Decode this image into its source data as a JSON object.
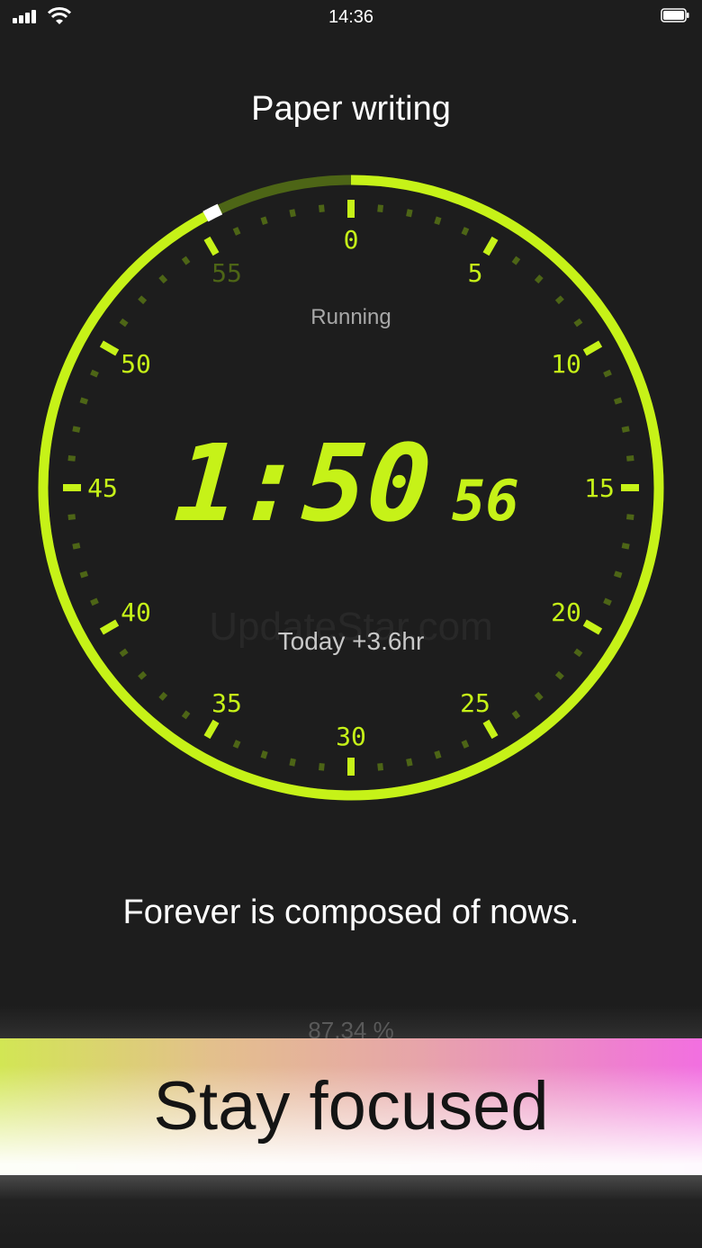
{
  "status_bar": {
    "time": "14:36",
    "icons": [
      "cellular-signal-icon",
      "wifi-icon",
      "battery-icon"
    ]
  },
  "title": "Paper writing",
  "timer": {
    "status": "Running",
    "hours_minutes": "1:50",
    "seconds": "56",
    "today": "Today +3.6hr",
    "progress_fraction": 0.93,
    "dial_labels": [
      "0",
      "5",
      "10",
      "15",
      "20",
      "25",
      "30",
      "35",
      "40",
      "45",
      "50",
      "55"
    ]
  },
  "watermark": "UpdateStar.com",
  "quote": "Forever is composed of nows.",
  "percent": "87.34 %",
  "focus_button": {
    "label": "Stay focused"
  },
  "colors": {
    "background": "#1d1d1d",
    "accent": "#c6f218",
    "accent_dim": "#4d6516",
    "text": "#ffffff",
    "gradient_left": "#d2e654",
    "gradient_right": "#f26fe0"
  }
}
